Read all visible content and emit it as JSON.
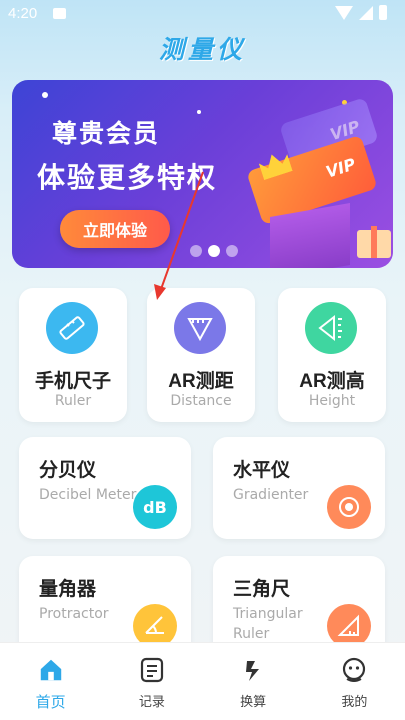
{
  "status_bar": {
    "time": "4:20"
  },
  "app_title": "测量仪",
  "banner": {
    "line1": "尊贵会员",
    "line2": "体验更多特权",
    "button": "立即体验",
    "vip_label": "VIP",
    "vip_label_faded": "VIP"
  },
  "tools_top": [
    {
      "name": "手机尺子",
      "sub": "Ruler",
      "icon": "ruler-icon",
      "color": "#3cb8f0"
    },
    {
      "name": "AR测距",
      "sub": "Distance",
      "icon": "protractor-distance-icon",
      "color": "#7b78e8"
    },
    {
      "name": "AR测高",
      "sub": "Height",
      "icon": "height-icon",
      "color": "#3fd6a0"
    }
  ],
  "tools_wide": [
    {
      "name": "分贝仪",
      "sub": "Decibel Meter",
      "icon_text": "dB",
      "icon": "decibel-icon",
      "color": "#1ec6d8"
    },
    {
      "name": "水平仪",
      "sub": "Gradienter",
      "icon": "level-icon",
      "color": "#ff8a5a"
    },
    {
      "name": "量角器",
      "sub": "Protractor",
      "icon": "protractor-icon",
      "color": "#ffc43a"
    },
    {
      "name": "三角尺",
      "sub": "Triangular Ruler",
      "icon": "triangle-ruler-icon",
      "color": "#ff8a5a"
    }
  ],
  "bottom_nav": [
    {
      "label": "首页",
      "icon": "home-icon",
      "active": true
    },
    {
      "label": "记录",
      "icon": "record-icon",
      "active": false
    },
    {
      "label": "换算",
      "icon": "convert-icon",
      "active": false
    },
    {
      "label": "我的",
      "icon": "profile-icon",
      "active": false
    }
  ],
  "colors": {
    "accent": "#2ea8e8",
    "banner_start": "#3d44d6",
    "banner_end": "#9b4fe2",
    "button_orange": "#ff6a3a"
  }
}
